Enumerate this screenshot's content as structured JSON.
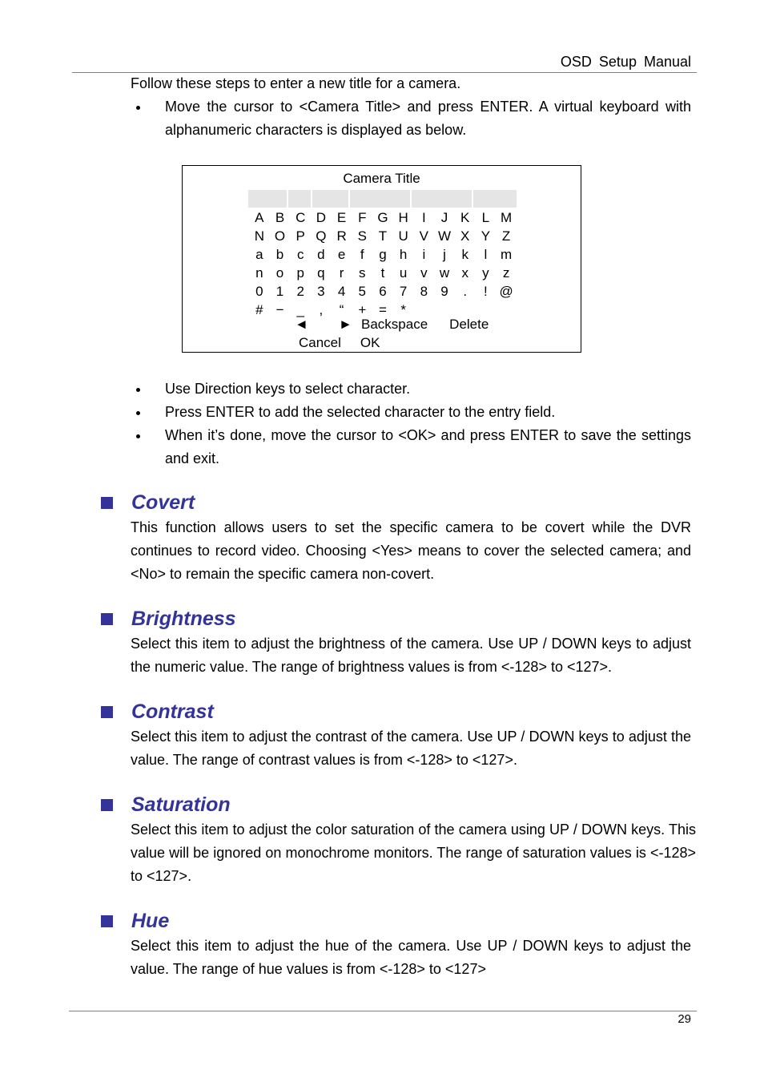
{
  "header": {
    "title": "OSD Setup Manual"
  },
  "intro": {
    "text": "Follow these steps to enter a new title for a camera.",
    "bullets": [
      "Move the cursor to <Camera Title> and press ENTER. A virtual keyboard with alphanumeric characters is displayed as below."
    ]
  },
  "keyboard": {
    "title": "Camera Title",
    "entry_value": "",
    "rows": [
      [
        "A",
        "B",
        "C",
        "D",
        "E",
        "F",
        "G",
        "H",
        "I",
        "J",
        "K",
        "L",
        "M"
      ],
      [
        "N",
        "O",
        "P",
        "Q",
        "R",
        "S",
        "T",
        "U",
        "V",
        "W",
        "X",
        "Y",
        "Z"
      ],
      [
        "a",
        "b",
        "c",
        "d",
        "e",
        "f",
        "g",
        "h",
        "i",
        "j",
        "k",
        "l",
        "m"
      ],
      [
        "n",
        "o",
        "p",
        "q",
        "r",
        "s",
        "t",
        "u",
        "v",
        "w",
        "x",
        "y",
        "z"
      ],
      [
        "0",
        "1",
        "2",
        "3",
        "4",
        "5",
        "6",
        "7",
        "8",
        "9",
        ".",
        "!",
        "@"
      ],
      [
        "#",
        "−",
        "_",
        ",",
        "“",
        "+",
        "=",
        "*"
      ]
    ],
    "nav": {
      "left": "◄",
      "right": "►",
      "backspace": "Backspace",
      "delete": "Delete"
    },
    "actions": {
      "cancel": "Cancel",
      "ok": "OK"
    }
  },
  "steps": [
    "Use Direction keys to select character.",
    "Press ENTER to add the selected character to the entry field.",
    "When it’s done, move the cursor to <OK> and press ENTER to save the settings and exit."
  ],
  "sections": [
    {
      "title": "Covert",
      "body": "This function allows users to set the specific camera to be covert while the DVR continues to record video. Choosing <Yes> means to cover the selected camera; and <No> to remain the specific camera non-covert."
    },
    {
      "title": "Brightness",
      "body": "Select this item to adjust the brightness of the camera. Use UP / DOWN keys to adjust the numeric value. The range of brightness values is from <-128> to <127>."
    },
    {
      "title": "Contrast",
      "body": "Select this item to adjust the contrast of the camera. Use UP / DOWN keys to adjust the value. The range of contrast values is from <-128> to <127>."
    },
    {
      "title": "Saturation",
      "body": "Select this item to adjust the color saturation of the camera using UP / DOWN keys. This value will be ignored on monochrome monitors. The range of saturation values is <-128> to <127>."
    },
    {
      "title": "Hue",
      "body": "Select this item to adjust the hue of the camera. Use UP / DOWN keys to adjust the value. The range of hue values is from <-128> to <127>"
    }
  ],
  "footer": {
    "page_number": "29"
  },
  "colors": {
    "heading": "#333399",
    "entry_field": "#e5e5e5",
    "rule": "#808080"
  }
}
